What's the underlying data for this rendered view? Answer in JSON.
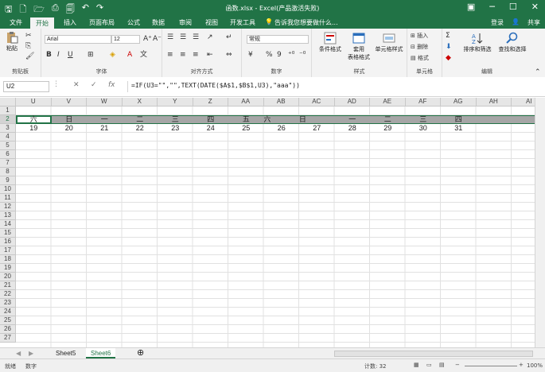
{
  "window": {
    "title": "函数.xlsx - Excel(产品激活失败)",
    "qat_icons": [
      "save-icon",
      "new-icon",
      "open-icon",
      "print-icon",
      "print-preview-icon",
      "undo-icon",
      "redo-icon"
    ]
  },
  "tabs": [
    {
      "label": "文件"
    },
    {
      "label": "开始"
    },
    {
      "label": "插入"
    },
    {
      "label": "页面布局"
    },
    {
      "label": "公式"
    },
    {
      "label": "数据"
    },
    {
      "label": "审阅"
    },
    {
      "label": "视图"
    },
    {
      "label": "开发工具"
    }
  ],
  "tellme": "告诉我您想要做什么...",
  "account": {
    "login": "登录",
    "share": "共享"
  },
  "ribbon": {
    "clipboard": {
      "paste": "粘贴",
      "label": "剪贴板"
    },
    "font": {
      "name": "Arial",
      "size": "12",
      "label": "字体",
      "bold": "B",
      "italic": "I",
      "underline": "U"
    },
    "align": {
      "label": "对齐方式"
    },
    "number": {
      "format": "常规",
      "label": "数字",
      "percent": "%",
      "comma": "9"
    },
    "styles": {
      "conditional": "条件格式",
      "table1": "套用",
      "table2": "表格格式",
      "cell_styles": "单元格样式",
      "label": "样式"
    },
    "cells": {
      "insert": "插入",
      "delete": "删除",
      "format": "格式",
      "label": "单元格"
    },
    "editing": {
      "sort": "排序和筛选",
      "find": "查找和选择",
      "label": "编辑"
    }
  },
  "formula_bar": {
    "name_box": "U2",
    "cancel": "✕",
    "confirm": "✓",
    "fx": "fx",
    "formula": "=IF(U3=\"\",\"\",TEXT(DATE($A$1,$B$1,U3),\"aaa\"))"
  },
  "columns": [
    "U",
    "V",
    "W",
    "X",
    "Y",
    "Z",
    "AA",
    "AB",
    "AC",
    "AD",
    "AE",
    "AF",
    "AG",
    "AH",
    "AI"
  ],
  "rows": [
    "1",
    "2",
    "3",
    "4",
    "5",
    "6",
    "7",
    "8",
    "9",
    "10",
    "11",
    "12",
    "13",
    "14",
    "15",
    "16",
    "17",
    "18",
    "19",
    "20",
    "21",
    "22",
    "23",
    "24",
    "25",
    "26",
    "27"
  ],
  "row2_days": [
    "六",
    "日",
    "一",
    "二",
    "三",
    "四",
    "五",
    "六",
    "日",
    "一",
    "二",
    "三",
    "四"
  ],
  "row2_positions": [
    0,
    1,
    2,
    3,
    4,
    5,
    6,
    6.6,
    7.6,
    9,
    10,
    11,
    12
  ],
  "row3_values": [
    "19",
    "20",
    "21",
    "22",
    "23",
    "24",
    "25",
    "26",
    "27",
    "28",
    "29",
    "30",
    "31"
  ],
  "sheets": [
    {
      "label": "Sheet5"
    },
    {
      "label": "Sheet6",
      "active": true
    }
  ],
  "status": {
    "ready": "就绪",
    "mode": "数字",
    "count": "计数: 32",
    "zoom": "100%"
  },
  "accent": "#217346"
}
